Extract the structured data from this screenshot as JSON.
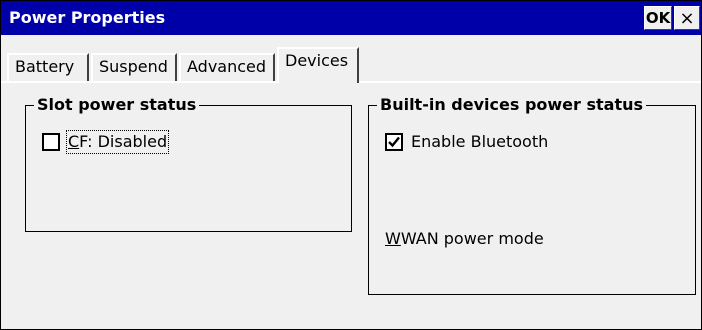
{
  "window": {
    "title": "Power Properties",
    "titlebar_color": "#0000a8",
    "ok_label": "OK",
    "close_label": "×"
  },
  "tabs": [
    {
      "label": "Battery",
      "active": false
    },
    {
      "label": "Suspend",
      "active": false
    },
    {
      "label": "Advanced",
      "active": false
    },
    {
      "label": "Devices",
      "active": true
    }
  ],
  "slot_group": {
    "title": "Slot power status",
    "cf": {
      "underline_char": "C",
      "rest": "F: Disabled",
      "checked": false
    }
  },
  "builtin_group": {
    "title": "Built-in devices power status",
    "bluetooth": {
      "label": "Enable Bluetooth",
      "checked": true
    },
    "wwan": {
      "underline_char": "W",
      "rest": "WAN power mode"
    }
  },
  "icons": {
    "close": "close-icon",
    "check": "checkmark-icon"
  }
}
